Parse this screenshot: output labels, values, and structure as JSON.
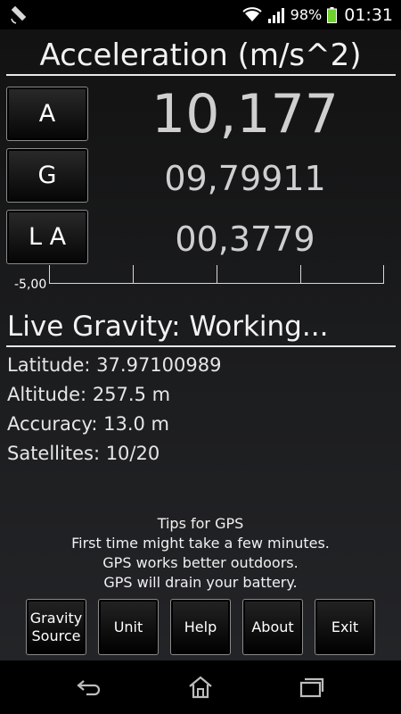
{
  "status_bar": {
    "battery_percent": "98%",
    "time": "01:31",
    "icons": [
      "gps-satellite-icon",
      "wifi-icon",
      "signal-icon",
      "battery-icon"
    ]
  },
  "header": {
    "title": "Acceleration (m/s^2)"
  },
  "readings": {
    "a": {
      "button_label": "A",
      "value": "10,177"
    },
    "g": {
      "button_label": "G",
      "value": "09,79911"
    },
    "la": {
      "button_label": "L A",
      "value": "00,3779"
    }
  },
  "scale": {
    "min_label": "-5,00"
  },
  "gps": {
    "status_title": "Live Gravity: Working...",
    "latitude": "Latitude: 37.97100989",
    "altitude": "Altitude: 257.5 m",
    "accuracy": "Accuracy: 13.0 m",
    "satellites": "Satellites: 10/20"
  },
  "tips": {
    "title": "Tips for GPS",
    "line1": "First time might take a few minutes.",
    "line2": "GPS works better outdoors.",
    "line3": "GPS will drain your battery."
  },
  "buttons": {
    "gravity_source_line1": "Gravity",
    "gravity_source_line2": "Source",
    "unit": "Unit",
    "help": "Help",
    "about": "About",
    "exit": "Exit"
  },
  "colors": {
    "accent": "#ffffff",
    "value_text": "#cfcfcf",
    "battery": "#6fd32e"
  }
}
